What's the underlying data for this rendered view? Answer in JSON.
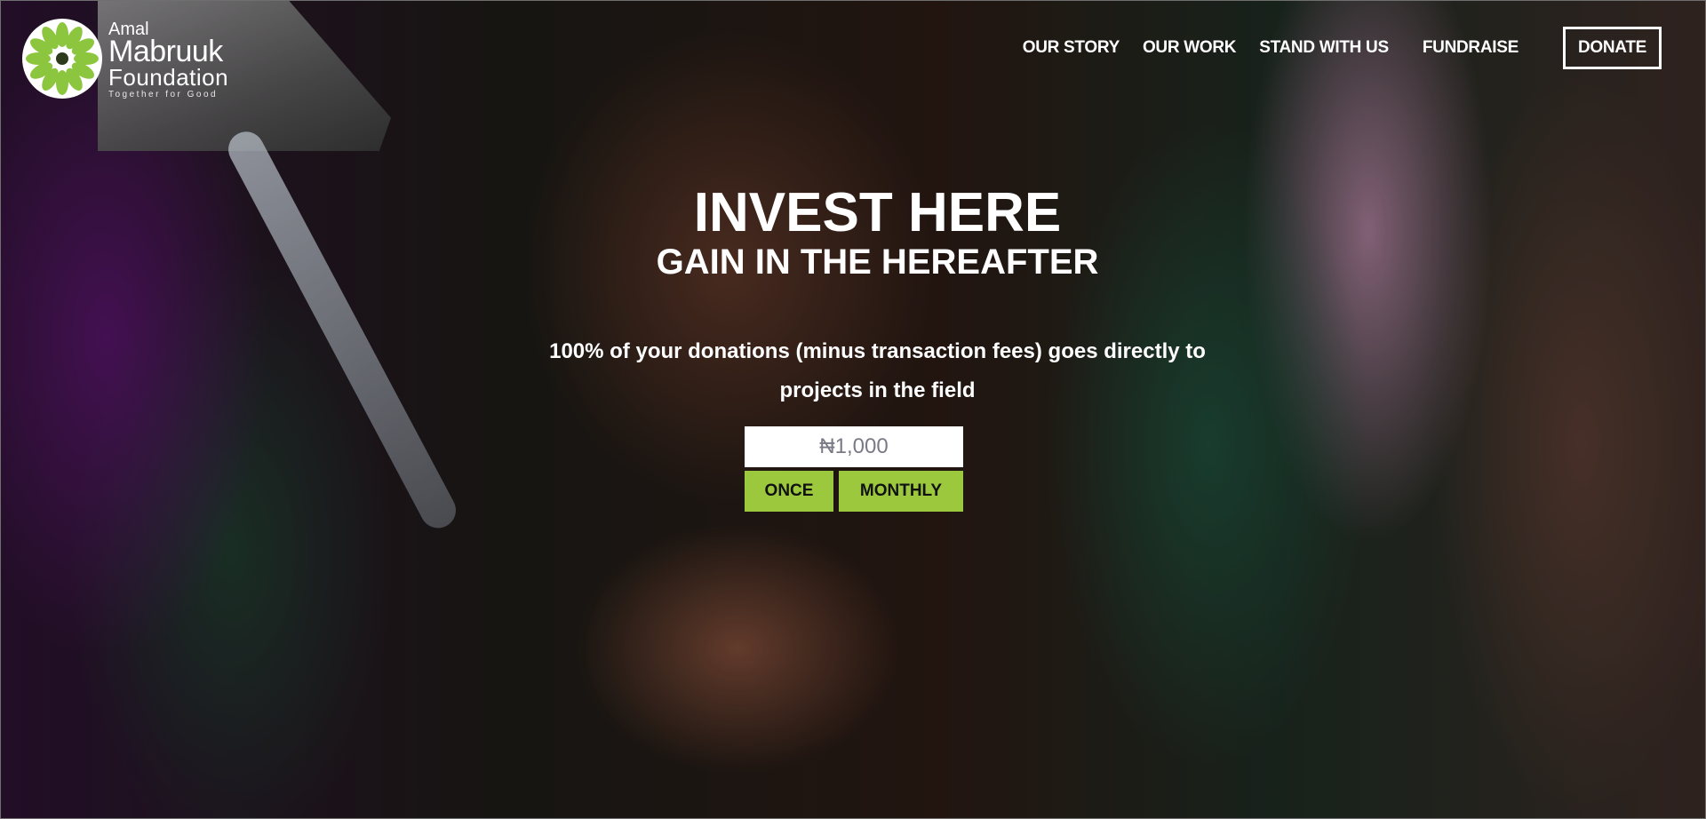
{
  "logo": {
    "line1": "Amal",
    "line2": "Mabruuk",
    "line3": "Foundation",
    "tagline": "Together for Good",
    "icon": "flower-logo-icon",
    "color": "#8cc63f"
  },
  "nav": {
    "items": [
      "OUR STORY",
      "OUR WORK",
      "STAND WITH US",
      "FUNDRAISE"
    ],
    "donate": "DONATE"
  },
  "hero": {
    "headline": "INVEST HERE",
    "subheadline": "GAIN IN THE HEREAFTER",
    "description": "100% of your donations (minus transaction fees) goes directly to projects in the field",
    "amount_value": "₦1,000",
    "once_label": "ONCE",
    "monthly_label": "MONTHLY",
    "accent_color": "#9bc83c"
  }
}
